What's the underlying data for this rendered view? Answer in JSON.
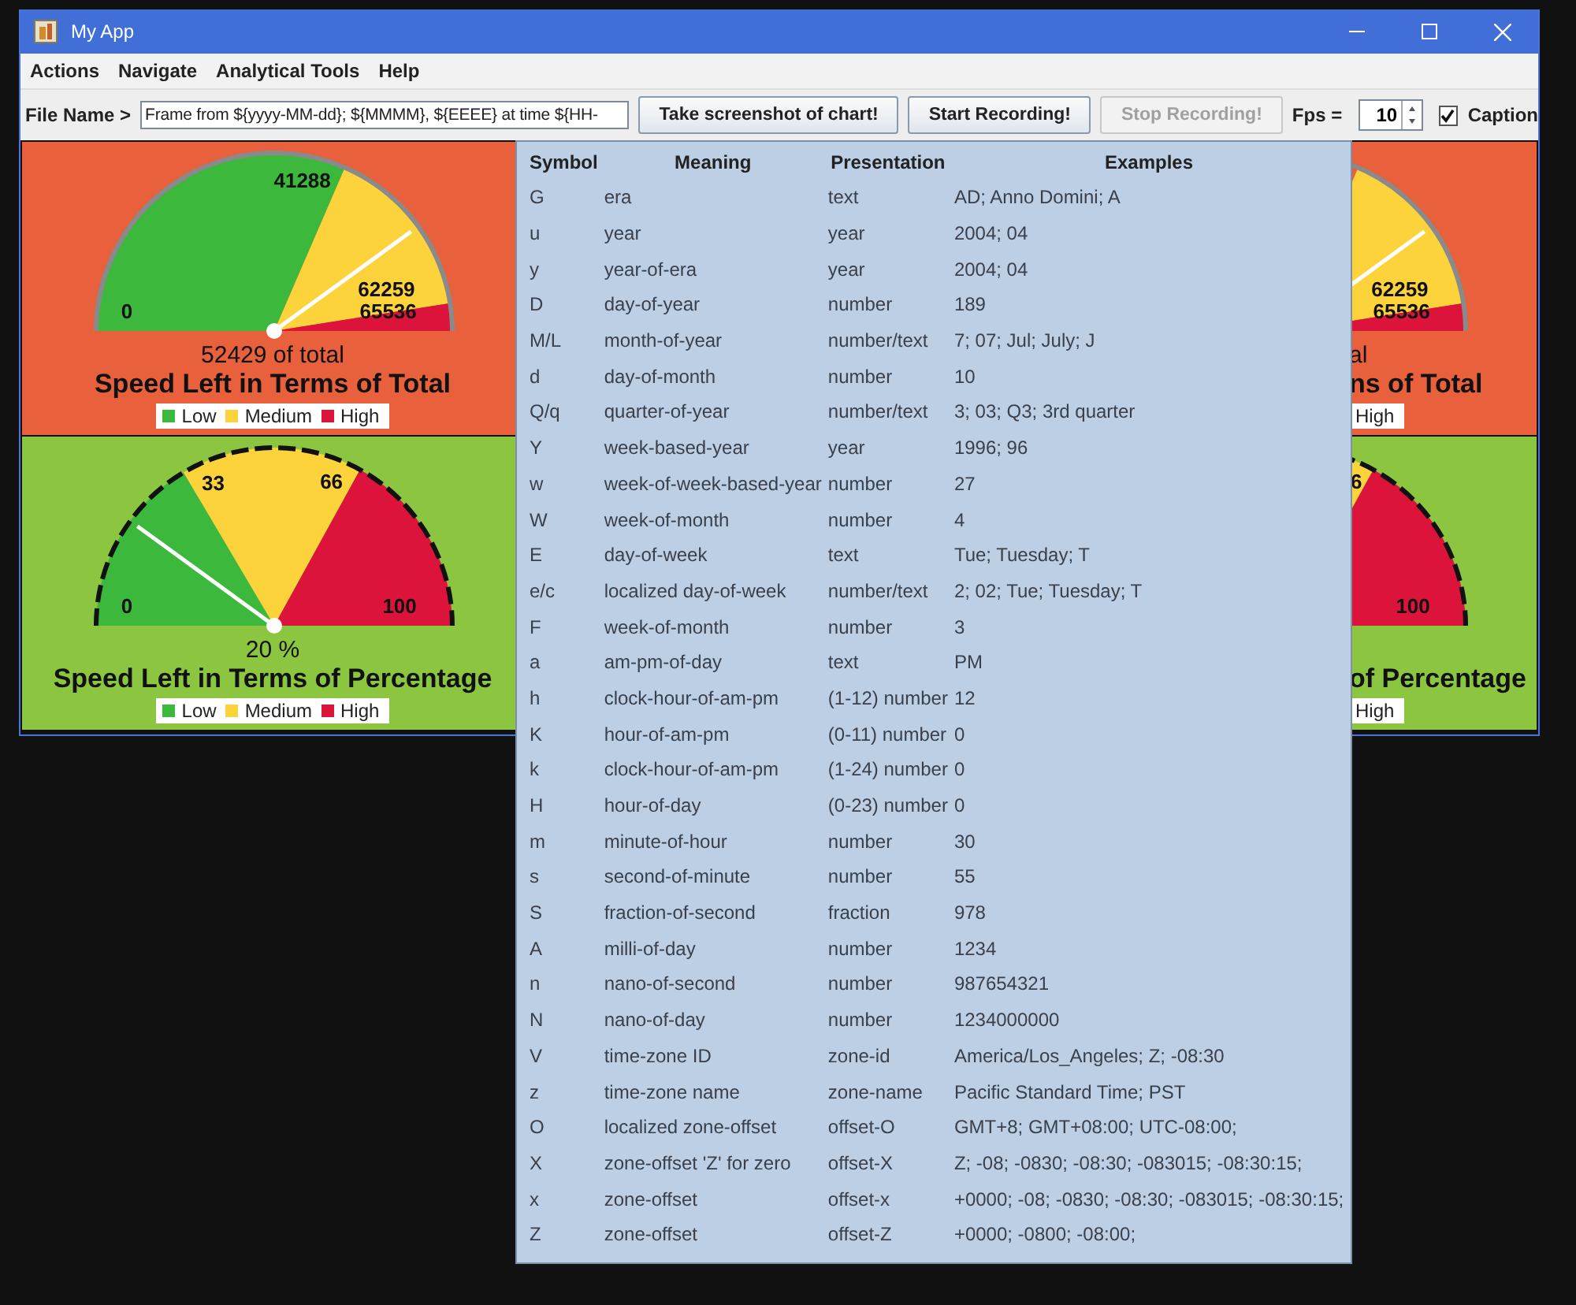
{
  "window": {
    "title": "My App"
  },
  "menu": [
    "Actions",
    "Navigate",
    "Analytical Tools",
    "Help"
  ],
  "toolbar": {
    "file_label": "File Name >",
    "file_name": "Frame from ${yyyy-MM-dd}; ${MMMM}, ${EEEE} at time ${HH-",
    "buttons": [
      {
        "label": "Take screenshot of chart!",
        "disabled": false
      },
      {
        "label": "Start Recording!",
        "disabled": false
      },
      {
        "label": "Stop Recording!",
        "disabled": true
      }
    ],
    "fps_label": "Fps =",
    "fps": "10",
    "caption": {
      "label": "Caption",
      "checked": true
    }
  },
  "gauges": [
    {
      "color": "#e8603c",
      "dashed_rim": false,
      "level": 0.8,
      "scale": [
        "0",
        "41288",
        "62259",
        "65536"
      ],
      "value_text": "52429 of total",
      "title": "Speed Left in Terms of Total",
      "segments": [
        {
          "label": "Low",
          "color": "#3cb83c"
        },
        {
          "label": "Medium",
          "color": "#fdd33c"
        },
        {
          "label": "High",
          "color": "#dc143c"
        }
      ]
    },
    {
      "color": "#8cc540",
      "dashed_rim": true,
      "level": 0.2,
      "scale": [
        "0",
        "33",
        "66",
        "100"
      ],
      "value_text": "20 %",
      "title": "Speed Left in Terms of Percentage",
      "segments": [
        {
          "label": "Low",
          "color": "#3cb83c"
        },
        {
          "label": "Medium",
          "color": "#fdd33c"
        },
        {
          "label": "High",
          "color": "#dc143c"
        }
      ]
    }
  ],
  "right_column": [
    {
      "scale": [
        "62259",
        "65536"
      ],
      "value_text": "al",
      "title": "ns of Total",
      "legend": [
        "High"
      ]
    },
    {
      "scale": [
        "6",
        "100"
      ],
      "title": "of Percentage",
      "legend": [
        "High"
      ]
    }
  ],
  "format_popup": {
    "columns": [
      "Symbol",
      "Meaning",
      "Presentation",
      "Examples"
    ],
    "rows": [
      [
        "G",
        "era",
        "text",
        "AD; Anno Domini; A"
      ],
      [
        "u",
        "year",
        "year",
        "2004; 04"
      ],
      [
        "y",
        "year-of-era",
        "year",
        "2004; 04"
      ],
      [
        "D",
        "day-of-year",
        "number",
        "189"
      ],
      [
        "M/L",
        "month-of-year",
        "number/text",
        "7; 07; Jul; July; J"
      ],
      [
        "d",
        "day-of-month",
        "number",
        "10"
      ],
      [
        "Q/q",
        "quarter-of-year",
        "number/text",
        "3; 03; Q3; 3rd quarter"
      ],
      [
        "Y",
        "week-based-year",
        "year",
        "1996; 96"
      ],
      [
        "w",
        "week-of-week-based-year",
        "number",
        "27"
      ],
      [
        "W",
        "week-of-month",
        "number",
        "4"
      ],
      [
        "E",
        "day-of-week",
        "text",
        "Tue; Tuesday; T"
      ],
      [
        "e/c",
        "localized day-of-week",
        "number/text",
        "2; 02; Tue; Tuesday; T"
      ],
      [
        "F",
        "week-of-month",
        "number",
        "3"
      ],
      [
        "a",
        "am-pm-of-day",
        "text",
        "PM"
      ],
      [
        "h",
        "clock-hour-of-am-pm",
        "(1-12) number",
        "12"
      ],
      [
        "K",
        "hour-of-am-pm",
        "(0-11) number",
        "0"
      ],
      [
        "k",
        "clock-hour-of-am-pm",
        "(1-24) number",
        "0"
      ],
      [
        "H",
        "hour-of-day",
        "(0-23) number",
        "0"
      ],
      [
        "m",
        "minute-of-hour",
        "number",
        "30"
      ],
      [
        "s",
        "second-of-minute",
        "number",
        "55"
      ],
      [
        "S",
        "fraction-of-second",
        "fraction",
        "978"
      ],
      [
        "A",
        "milli-of-day",
        "number",
        "1234"
      ],
      [
        "n",
        "nano-of-second",
        "number",
        "987654321"
      ],
      [
        "N",
        "nano-of-day",
        "number",
        "1234000000"
      ],
      [
        "V",
        "time-zone ID",
        "zone-id",
        "America/Los_Angeles; Z; -08:30"
      ],
      [
        "z",
        "time-zone name",
        "zone-name",
        "Pacific Standard Time; PST"
      ],
      [
        "O",
        "localized zone-offset",
        "offset-O",
        "GMT+8; GMT+08:00; UTC-08:00;"
      ],
      [
        "X",
        "zone-offset 'Z' for zero",
        "offset-X",
        "Z; -08; -0830; -08:30; -083015; -08:30:15;"
      ],
      [
        "x",
        "zone-offset",
        "offset-x",
        "+0000; -08; -0830; -08:30; -083015; -08:30:15;"
      ],
      [
        "Z",
        "zone-offset",
        "offset-Z",
        "+0000; -0800; -08:00;"
      ]
    ]
  }
}
